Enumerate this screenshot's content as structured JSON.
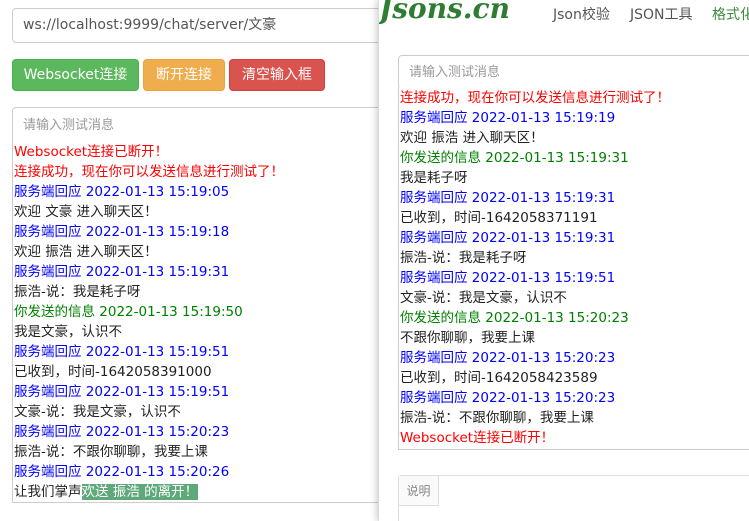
{
  "left": {
    "url": "ws://localhost:9999/chat/server/文豪",
    "buttons": {
      "connect": "Websocket连接",
      "disconnect": "断开连接",
      "clear": "清空输入框"
    },
    "message_placeholder": "请输入测试消息",
    "log": [
      {
        "text": "Websocket连接已断开！",
        "color": "red"
      },
      {
        "text": "连接成功，现在你可以发送信息进行测试了！",
        "color": "red"
      },
      {
        "text": "服务端回应 2022-01-13 15:19:05",
        "color": "blue"
      },
      {
        "text": "欢迎 文豪 进入聊天区！",
        "color": "black"
      },
      {
        "text": "服务端回应 2022-01-13 15:19:18",
        "color": "blue"
      },
      {
        "text": "欢迎 振浩 进入聊天区！",
        "color": "black"
      },
      {
        "text": "服务端回应 2022-01-13 15:19:31",
        "color": "blue"
      },
      {
        "text": "振浩-说：我是耗子呀",
        "color": "black"
      },
      {
        "text": "你发送的信息 2022-01-13 15:19:50",
        "color": "green"
      },
      {
        "text": "我是文豪，认识不",
        "color": "black"
      },
      {
        "text": "服务端回应 2022-01-13 15:19:51",
        "color": "blue"
      },
      {
        "text": "已收到，时间-1642058391000",
        "color": "black"
      },
      {
        "text": "服务端回应 2022-01-13 15:19:51",
        "color": "blue"
      },
      {
        "text": "文豪-说：我是文豪，认识不",
        "color": "black"
      },
      {
        "text": "服务端回应 2022-01-13 15:20:23",
        "color": "blue"
      },
      {
        "text": "振浩-说：不跟你聊聊，我要上课",
        "color": "black"
      },
      {
        "text": "服务端回应 2022-01-13 15:20:26",
        "color": "blue"
      }
    ],
    "last_line": {
      "prefix": "让我们掌声",
      "highlight": "欢送 振浩 的离开！"
    }
  },
  "right": {
    "logo": "Jsons.cn",
    "nav": [
      "Json校验",
      "JSON工具",
      "格式化"
    ],
    "message_placeholder": "请输入测试消息",
    "log": [
      {
        "text": "连接成功，现在你可以发送信息进行测试了！",
        "color": "red"
      },
      {
        "text": "服务端回应 2022-01-13 15:19:19",
        "color": "blue"
      },
      {
        "text": "欢迎 振浩 进入聊天区！",
        "color": "black"
      },
      {
        "text": "你发送的信息 2022-01-13 15:19:31",
        "color": "green"
      },
      {
        "text": "我是耗子呀",
        "color": "black"
      },
      {
        "text": "服务端回应 2022-01-13 15:19:31",
        "color": "blue"
      },
      {
        "text": "已收到，时间-1642058371191",
        "color": "black"
      },
      {
        "text": "服务端回应 2022-01-13 15:19:31",
        "color": "blue"
      },
      {
        "text": "振浩-说：我是耗子呀",
        "color": "black"
      },
      {
        "text": "服务端回应 2022-01-13 15:19:51",
        "color": "blue"
      },
      {
        "text": "文豪-说：我是文豪，认识不",
        "color": "black"
      },
      {
        "text": "你发送的信息 2022-01-13 15:20:23",
        "color": "green"
      },
      {
        "text": "不跟你聊聊，我要上课",
        "color": "black"
      },
      {
        "text": "服务端回应 2022-01-13 15:20:23",
        "color": "blue"
      },
      {
        "text": "已收到，时间-1642058423589",
        "color": "black"
      },
      {
        "text": "服务端回应 2022-01-13 15:20:23",
        "color": "blue"
      },
      {
        "text": "振浩-说：不跟你聊聊，我要上课",
        "color": "black"
      },
      {
        "text": "Websocket连接已断开！",
        "color": "red"
      }
    ],
    "desc_label": "说明"
  },
  "colors": {
    "red": "#ff0000",
    "blue": "#0000ff",
    "green": "#008000",
    "black": "#222222",
    "btn_green": "#5cb85c",
    "btn_orange": "#f0ad4e",
    "btn_red": "#d9534f",
    "highlight": "#5fa87a"
  }
}
